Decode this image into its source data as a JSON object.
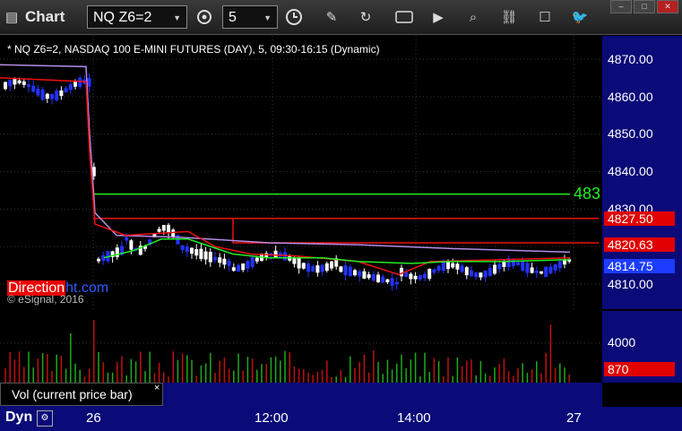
{
  "app": {
    "title": "Chart"
  },
  "toolbar": {
    "symbol_value": "NQ Z6=2",
    "interval_value": "5"
  },
  "chart_info": "* NQ Z6=2, NASDAQ 100 E-MINI FUTURES (DAY), 5, 09:30-16:15 (Dynamic)",
  "watermark": {
    "part1": "Direction",
    "part2": "ht.com"
  },
  "copyright": "© eSignal, 2016",
  "price_axis": {
    "ticks": [
      "4870.00",
      "4860.00",
      "4850.00",
      "4840.00",
      "4830.00",
      "4810.00"
    ],
    "tags": [
      {
        "text": "4827.50",
        "color": "#e00000"
      },
      {
        "text": "4820.63",
        "color": "#e00000"
      },
      {
        "text": "4814.75",
        "color": "#1c3cff"
      }
    ],
    "level_label": "483"
  },
  "vol_axis": {
    "tick": "4000",
    "tag": "870"
  },
  "study": {
    "label": "Vol (current price bar)",
    "close": "×"
  },
  "time_axis": {
    "labels": [
      "26",
      "12:00",
      "14:00",
      "27"
    ],
    "left_label": "Dyn"
  },
  "colors": {
    "axis_bg": "#0a0a78",
    "level_green": "#22ee22",
    "level_red": "#ee1111",
    "ma_purple": "#b58ce6",
    "up_candle": "#ffffff",
    "down_candle": "#2233ff"
  }
}
